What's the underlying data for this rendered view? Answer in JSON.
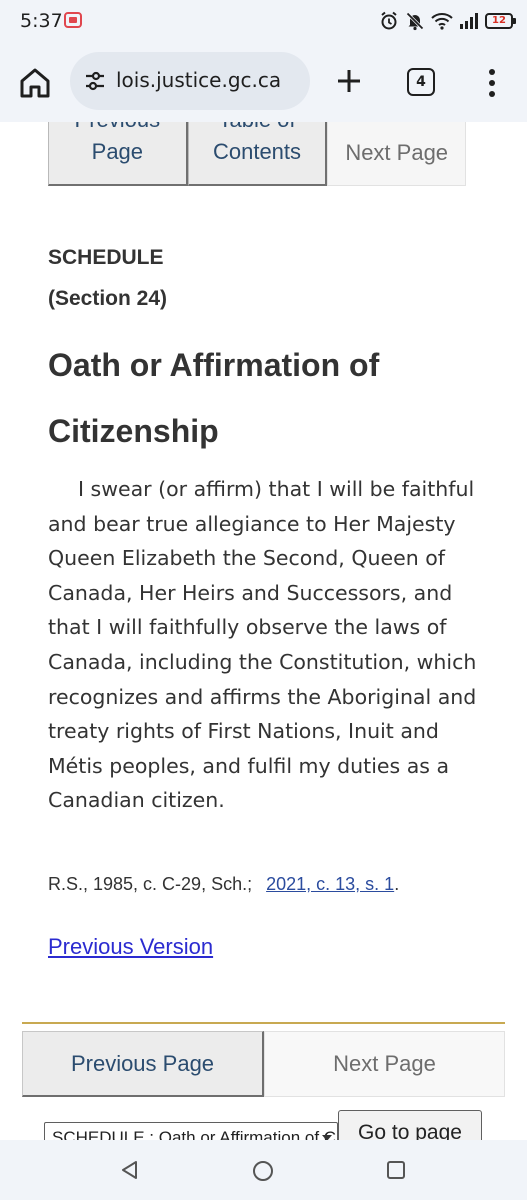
{
  "status_bar": {
    "time": "5:37",
    "battery": "12",
    "icons": [
      "alarm-icon",
      "mute-icon",
      "wifi-icon",
      "signal-icon",
      "battery-icon"
    ]
  },
  "browser": {
    "url": "lois.justice.gc.ca",
    "tab_count": "4"
  },
  "top_nav": {
    "previous": "Previous Page",
    "toc": "Table of Contents",
    "next": "Next Page"
  },
  "content": {
    "schedule": "SCHEDULE",
    "section": "(Section 24)",
    "title": "Oath or Affirmation of Citizenship",
    "oath": "I swear (or affirm) that I will be faithful and bear true allegiance to Her Majesty Queen Elizabeth the Second, Queen of Canada, Her Heirs and Successors, and that I will faithfully observe the laws of Canada, including the Constitution, which recognizes and affirms the Aboriginal and treaty rights of First Nations, Inuit and Métis peoples, and fulfil my duties as a Canadian citizen.",
    "history_prefix": "R.S., 1985, c. C-29, Sch.;",
    "history_link": "2021, c. 13, s. 1",
    "history_suffix": ".",
    "previous_version": "Previous Version"
  },
  "bottom_nav": {
    "previous": "Previous Page",
    "next": "Next Page"
  },
  "page_select": {
    "selected": "SCHEDULE : Oath or Affirmation of Citizenship",
    "go_label": "Go to page"
  },
  "colors": {
    "accent_gold": "#c8a951",
    "link": "#2b2bd0",
    "nav_text": "#2b4c6f"
  }
}
